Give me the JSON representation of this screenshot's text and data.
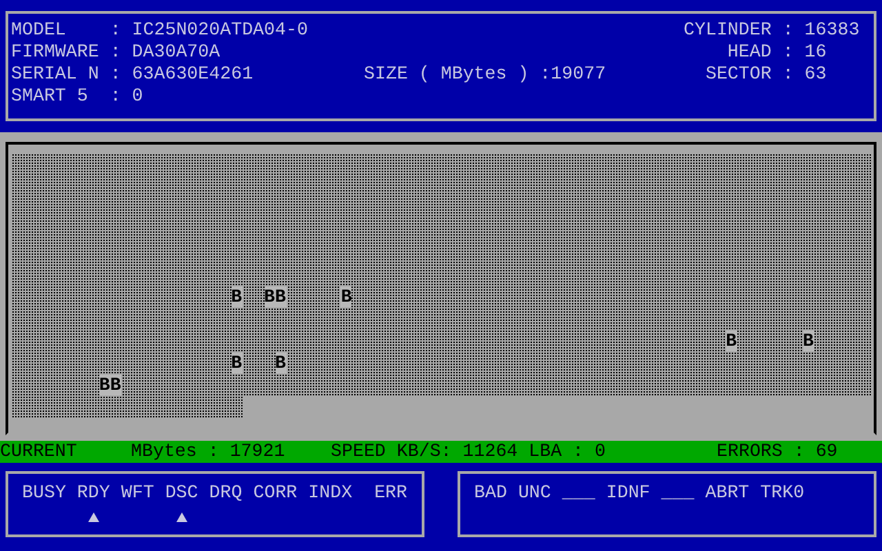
{
  "drive_info": {
    "left": [
      "MODEL    : IC25N020ATDA04-0",
      "FIRMWARE : DA30A70A",
      "SERIAL N : 63A630E4261",
      "SMART 5  : 0"
    ],
    "size": "SIZE ( MBytes ) :19077",
    "right": [
      "CYLINDER : 16383",
      "    HEAD : 16",
      "  SECTOR : 63"
    ]
  },
  "scan_map": {
    "level": 0.9391,
    "rows": [
      "                                                                              ",
      "                                                                              ",
      "                                                                              ",
      "                                                                              ",
      "                                                                              ",
      "                                                                              ",
      "                    B  BB     B",
      "                                                                              ",
      "                                                                 B      B",
      "                    B   B",
      "        BB",
      "                     "
    ]
  },
  "status_bar": [
    "CURRENT",
    "MBytes : 17921",
    "SPEED KB/S: 11264 LBA : 0",
    "ERRORS : 69"
  ],
  "register_flags": [
    {
      "label": "BUSY",
      "on": false
    },
    {
      "label": "RDY",
      "on": true
    },
    {
      "label": "WFT",
      "on": false
    },
    {
      "label": "DSC",
      "on": true
    },
    {
      "label": "DRQ",
      "on": false
    },
    {
      "label": "CORR",
      "on": false
    },
    {
      "label": "INDX",
      "on": false
    },
    {
      "label": "ERR",
      "on": false
    }
  ],
  "error_flags": [
    "BAD",
    "UNC",
    "___",
    "IDNF",
    "___",
    "ABRT",
    "TRK0"
  ]
}
